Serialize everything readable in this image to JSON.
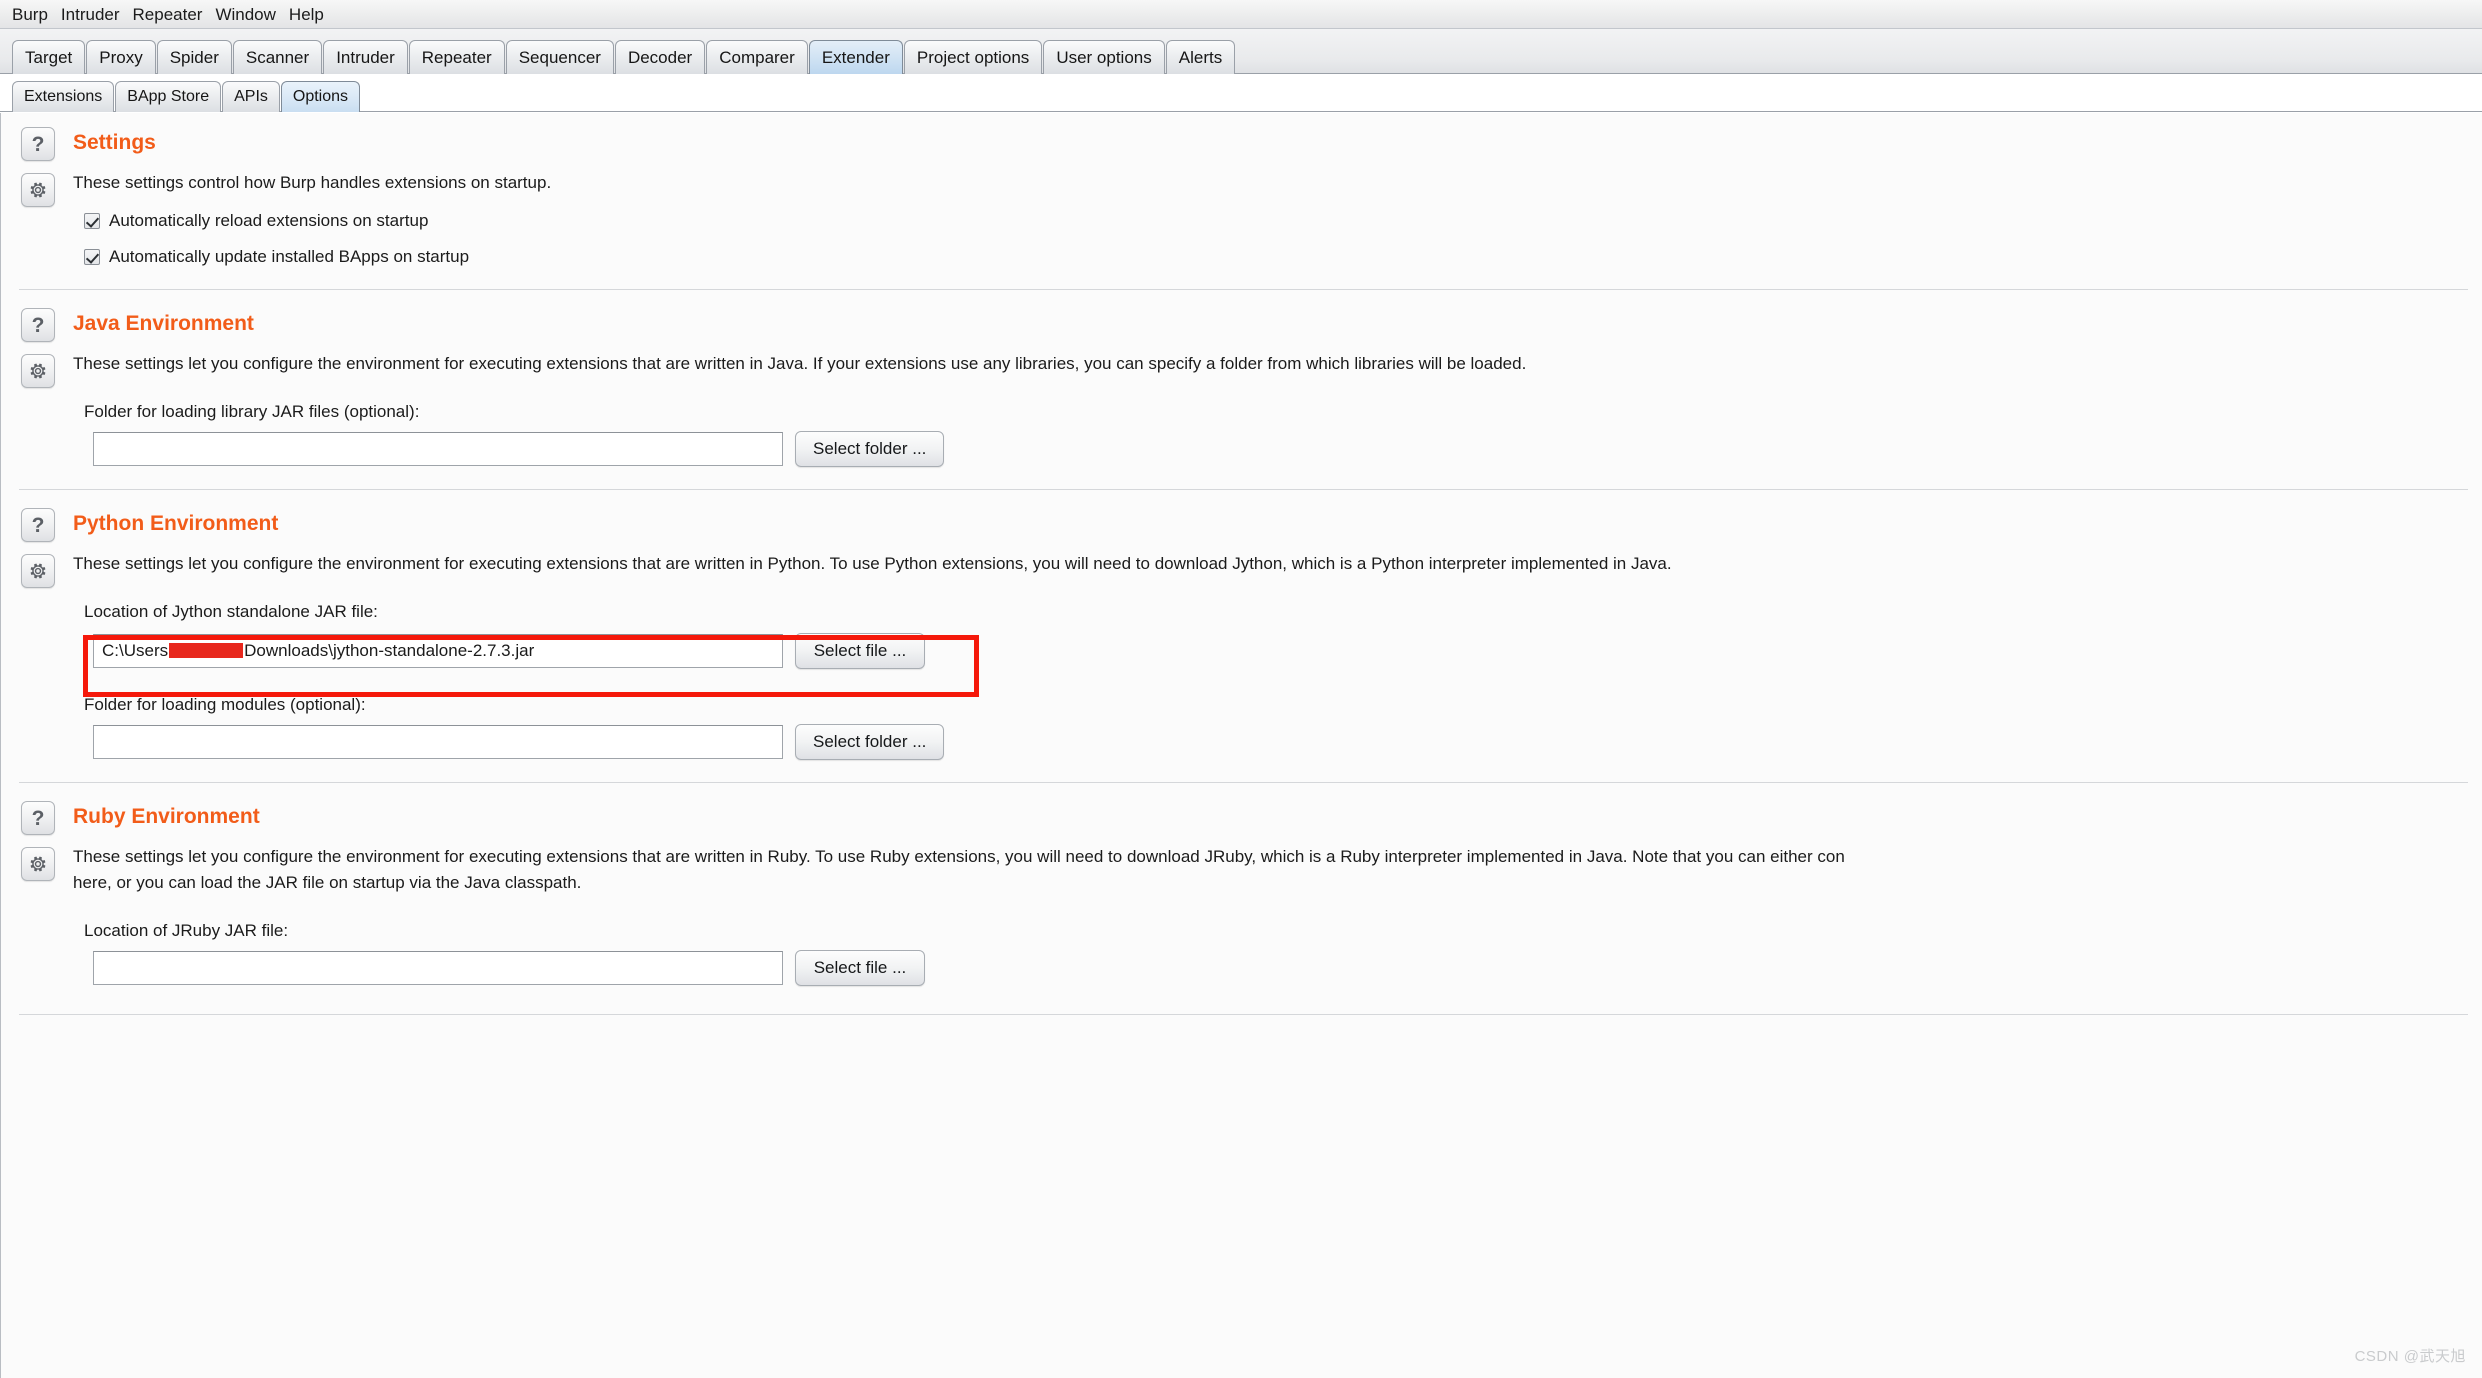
{
  "menubar": {
    "items": [
      "Burp",
      "Intruder",
      "Repeater",
      "Window",
      "Help"
    ]
  },
  "main_tabs": {
    "items": [
      {
        "label": "Target",
        "selected": false
      },
      {
        "label": "Proxy",
        "selected": false
      },
      {
        "label": "Spider",
        "selected": false
      },
      {
        "label": "Scanner",
        "selected": false
      },
      {
        "label": "Intruder",
        "selected": false
      },
      {
        "label": "Repeater",
        "selected": false
      },
      {
        "label": "Sequencer",
        "selected": false
      },
      {
        "label": "Decoder",
        "selected": false
      },
      {
        "label": "Comparer",
        "selected": false
      },
      {
        "label": "Extender",
        "selected": true
      },
      {
        "label": "Project options",
        "selected": false
      },
      {
        "label": "User options",
        "selected": false
      },
      {
        "label": "Alerts",
        "selected": false
      }
    ]
  },
  "sub_tabs": {
    "items": [
      {
        "label": "Extensions",
        "selected": false
      },
      {
        "label": "BApp Store",
        "selected": false
      },
      {
        "label": "APIs",
        "selected": false
      },
      {
        "label": "Options",
        "selected": true
      }
    ]
  },
  "icons": {
    "help": "?",
    "help_name": "question-mark-icon",
    "gear_name": "gear-icon"
  },
  "sections": {
    "settings": {
      "title": "Settings",
      "description": "These settings control how Burp handles extensions on startup.",
      "checkboxes": [
        {
          "label": "Automatically reload extensions on startup",
          "checked": true
        },
        {
          "label": "Automatically update installed BApps on startup",
          "checked": true
        }
      ]
    },
    "java": {
      "title": "Java Environment",
      "description": "These settings let you configure the environment for executing extensions that are written in Java. If your extensions use any libraries, you can specify a folder from which libraries will be loaded.",
      "field_label": "Folder for loading library JAR files (optional):",
      "field_value": "",
      "button_label": "Select folder ..."
    },
    "python": {
      "title": "Python Environment",
      "description": "These settings let you configure the environment for executing extensions that are written in Python. To use Python extensions, you will need to download Jython, which is a Python interpreter implemented in Java.",
      "jar_label": "Location of Jython standalone JAR file:",
      "jar_value_prefix": "C:\\Users",
      "jar_value_suffix": "Downloads\\jython-standalone-2.7.3.jar",
      "jar_button_label": "Select file ...",
      "modules_label": "Folder for loading modules (optional):",
      "modules_value": "",
      "modules_button_label": "Select folder ...",
      "highlight_color": "#f5180a"
    },
    "ruby": {
      "title": "Ruby Environment",
      "description": "These settings let you configure the environment for executing extensions that are written in Ruby. To use Ruby extensions, you will need to download JRuby, which is a Ruby interpreter implemented in Java. Note that you can either con",
      "description_line2": "here, or you can load the JAR file on startup via the Java classpath.",
      "field_label": "Location of JRuby JAR file:",
      "field_value": "",
      "button_label": "Select file ..."
    }
  },
  "watermark": "CSDN @武天旭",
  "colors": {
    "accent_orange": "#f25c19",
    "selected_tab_blue": "#bdd7ef",
    "annotation_red": "#f5180a"
  }
}
